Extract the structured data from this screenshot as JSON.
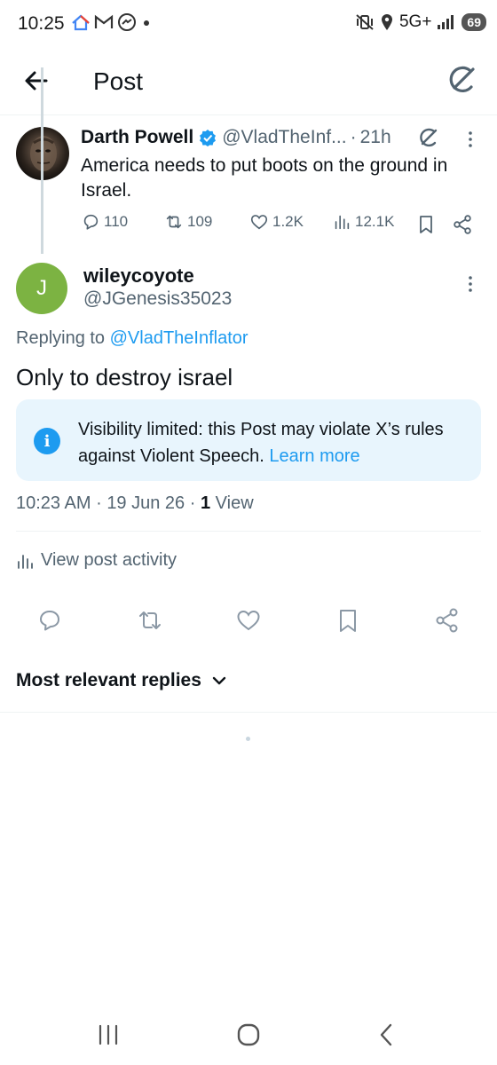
{
  "status_bar": {
    "time": "10:25",
    "network": "5G+",
    "battery": "69",
    "icons": [
      "home-icon",
      "gmail-icon",
      "messenger-icon",
      "dot-icon",
      "mute-vibrate-icon",
      "location-icon",
      "signal-icon",
      "battery-icon"
    ]
  },
  "header": {
    "title": "Post",
    "back_icon": "arrow-left-icon",
    "grok_icon": "grok-icon"
  },
  "parent_post": {
    "name": "Darth Powell",
    "handle": "@VladTheInf...",
    "separator": "·",
    "time": "21h",
    "text": "America needs to put boots on the ground in Israel.",
    "replies": "110",
    "reposts": "109",
    "likes": "1.2K",
    "views": "12.1K"
  },
  "reply_post": {
    "avatar_letter": "J",
    "avatar_color": "#7cb342",
    "name": "wileycoyote",
    "handle": "@JGenesis35023",
    "replying_prefix": "Replying to",
    "replying_handle": "@VladTheInflator",
    "text": "Only to destroy israel",
    "notice": {
      "icon": "i",
      "text": "Visibility limited: this Post may violate X’s rules against Violent Speech.",
      "link": "Learn more"
    },
    "timestamp": "10:23 AM",
    "separator": "·",
    "date": "19 Jun 26",
    "separator2": "·",
    "views_count": "1",
    "views_label": "View",
    "activity_label": "View post activity"
  },
  "replies_sort": {
    "label": "Most relevant replies"
  },
  "colors": {
    "accent": "#1d9bf0",
    "muted_text": "#536471",
    "notice_bg": "#e8f5fd"
  }
}
